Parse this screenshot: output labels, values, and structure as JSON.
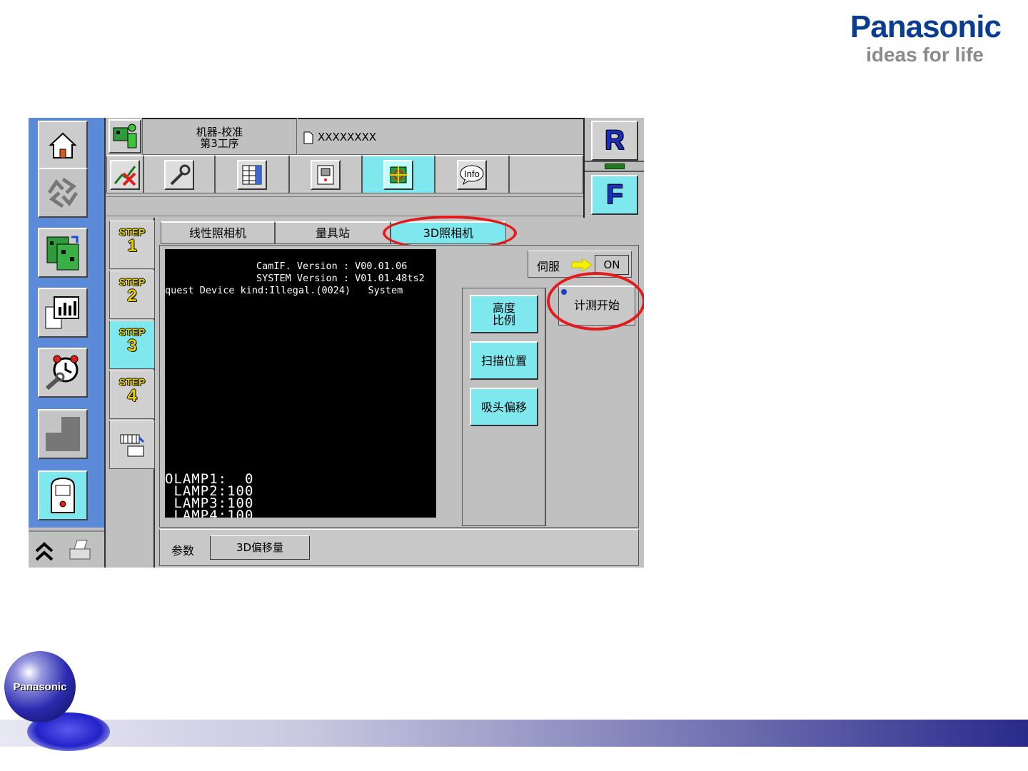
{
  "brand": {
    "name": "Panasonic",
    "tagline": "ideas for life",
    "badge": "Panasonic"
  },
  "header": {
    "title_line1": "机器-校准",
    "title_line2": "第3工序",
    "file_name": "XXXXXXXX"
  },
  "right_panel": {
    "r_label": "R",
    "f_label": "F"
  },
  "steps": [
    {
      "label": "STEP",
      "num": "1"
    },
    {
      "label": "STEP",
      "num": "2"
    },
    {
      "label": "STEP",
      "num": "3"
    },
    {
      "label": "STEP",
      "num": "4"
    }
  ],
  "tabs": [
    "线性照相机",
    "量具站",
    "3D照相机"
  ],
  "terminal": {
    "line1": "CamIF. Version : V00.01.06",
    "line2": "SYSTEM Version : V01.01.48ts2",
    "line3": "quest Device kind:Illegal.(0024)   System",
    "lamp1": "OLAMP1:  0",
    "lamp2": " LAMP2:100",
    "lamp3": " LAMP3:100",
    "lamp4": " LAMP4:100"
  },
  "servo": {
    "label": "伺服",
    "state": "ON"
  },
  "buttons": {
    "height_ratio_1": "高度",
    "height_ratio_2": "比例",
    "scan_position": "扫描位置",
    "nozzle_offset": "吸头偏移",
    "measure_start": "计测开始"
  },
  "param": {
    "label": "参数",
    "value": "3D偏移量"
  },
  "colors": {
    "accent_cyan": "#7fe7ee",
    "brand_blue": "#0a3d91",
    "highlight_red": "#e21b1b",
    "sidebar_blue": "#5a8ad8"
  }
}
